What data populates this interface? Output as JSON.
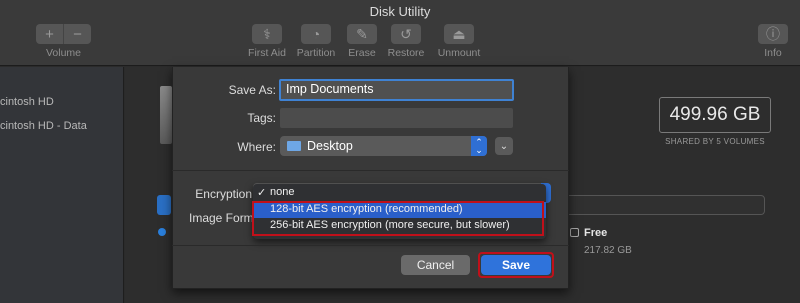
{
  "window": {
    "title": "Disk Utility"
  },
  "toolbar": {
    "volume_label": "Volume",
    "first_aid_label": "First Aid",
    "partition_label": "Partition",
    "erase_label": "Erase",
    "restore_label": "Restore",
    "unmount_label": "Unmount",
    "info_label": "Info"
  },
  "sidebar": {
    "items": [
      {
        "label": "cintosh HD"
      },
      {
        "label": "cintosh HD - Data"
      }
    ]
  },
  "main": {
    "capacity": "499.96 GB",
    "capacity_caption": "SHARED BY 5 VOLUMES",
    "free_label": "Free",
    "free_value": "217.82 GB"
  },
  "dialog": {
    "save_as_label": "Save As:",
    "save_as_value": "Imp Documents",
    "tags_label": "Tags:",
    "tags_value": "",
    "where_label": "Where:",
    "where_value": "Desktop",
    "encryption_label": "Encryption",
    "image_format_label": "Image Forma",
    "cancel_label": "Cancel",
    "save_label": "Save"
  },
  "encryption_menu": {
    "items": [
      {
        "label": "none",
        "check": "✓"
      },
      {
        "label": "128-bit AES encryption (recommended)",
        "check": ""
      },
      {
        "label": "256-bit AES encryption (more secure, but slower)",
        "check": ""
      }
    ]
  },
  "colors": {
    "accent": "#2f73db",
    "highlight_box": "#c0101a"
  }
}
